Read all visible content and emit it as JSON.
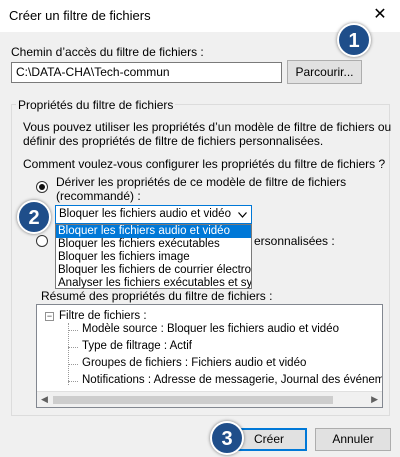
{
  "window": {
    "title": "Créer un filtre de fichiers",
    "close": "✕"
  },
  "path": {
    "label": "Chemin d’accès du filtre de fichiers :",
    "value": "C:\\DATA-CHA\\Tech-commun",
    "browse": "Parcourir..."
  },
  "props": {
    "group_title": "Propriétés du filtre de fichiers",
    "description_1": "Vous pouvez utiliser les propriétés d’un modèle de filtre de fichiers ou",
    "description_2": "définir des propriétés de filtre de fichiers personnalisées.",
    "question": "Comment voulez-vous configurer les propriétés du filtre de fichiers ?",
    "option1_line1": "Dériver les propriétés de ce modèle de filtre de fichiers",
    "option1_line2": "(recommandé) :",
    "option2_suffix": "ersonnalisées :",
    "combo_value": "Bloquer les fichiers audio et vidéo",
    "dropdown": [
      "Bloquer les fichiers audio et vidéo",
      "Bloquer les fichiers exécutables",
      "Bloquer les fichiers image",
      "Bloquer les fichiers de courrier électroniqu",
      "Analyser les fichiers exécutables et systèr"
    ],
    "summary_label": "Résumé des propriétés du filtre de fichiers :"
  },
  "summary_tree": {
    "root": "Filtre de fichiers :",
    "expander": "−",
    "items": [
      "Modèle source : Bloquer les fichiers audio et vidéo",
      "Type de filtrage : Actif",
      "Groupes de fichiers : Fichiers audio et vidéo",
      "Notifications : Adresse de messagerie, Journal des événem"
    ],
    "scroll_left": "◀",
    "scroll_right": "▶"
  },
  "buttons": {
    "create": "Créer",
    "cancel": "Annuler"
  },
  "badges": [
    "1",
    "2",
    "3"
  ],
  "colors": {
    "accent": "#0078d7",
    "badge": "#1f4e8a"
  }
}
